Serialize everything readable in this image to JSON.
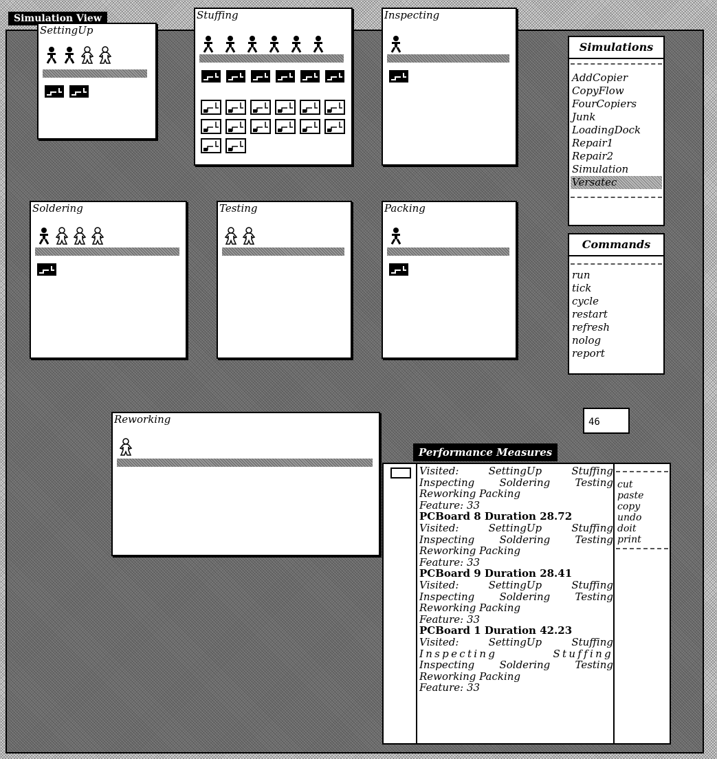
{
  "window": {
    "title": "Simulation View"
  },
  "stages": [
    {
      "title": "SettingUp",
      "workers": [
        "busy",
        "busy",
        "idle",
        "idle"
      ],
      "boards_done": 2,
      "boards_queued": 0
    },
    {
      "title": "Stuffing",
      "workers": [
        "busy",
        "busy",
        "busy",
        "busy",
        "busy",
        "busy"
      ],
      "boards_done": 6,
      "boards_queued": 14
    },
    {
      "title": "Inspecting",
      "workers": [
        "busy"
      ],
      "boards_done": 1,
      "boards_queued": 0
    },
    {
      "title": "Soldering",
      "workers": [
        "busy",
        "idle",
        "idle",
        "idle"
      ],
      "boards_done": 1,
      "boards_queued": 0
    },
    {
      "title": "Testing",
      "workers": [
        "idle",
        "idle"
      ],
      "boards_done": 0,
      "boards_queued": 0
    },
    {
      "title": "Packing",
      "workers": [
        "busy"
      ],
      "boards_done": 1,
      "boards_queued": 0
    },
    {
      "title": "Reworking",
      "workers": [
        "idle"
      ],
      "boards_done": 0,
      "boards_queued": 0
    }
  ],
  "simulations": {
    "title": "Simulations",
    "items": [
      "AddCopier",
      "CopyFlow",
      "FourCopiers",
      "Junk",
      "LoadingDock",
      "Repair1",
      "Repair2",
      "Simulation",
      "Versatec"
    ],
    "selected": "Versatec"
  },
  "commands": {
    "title": "Commands",
    "items": [
      "run",
      "tick",
      "cycle",
      "restart",
      "refresh",
      "nolog",
      "report"
    ]
  },
  "counter": {
    "value": "46"
  },
  "performance": {
    "title": "Performance Measures",
    "lines": [
      {
        "text": "Visited:  SettingUp  Stuffing",
        "style": "just"
      },
      {
        "text": "Inspecting  Soldering  Testing",
        "style": "just"
      },
      {
        "text": "Reworking Packing",
        "style": ""
      },
      {
        "text": "Feature: 33",
        "style": ""
      },
      {
        "text": "PCBoard 8 Duration 28.72",
        "style": "heading"
      },
      {
        "text": "Visited:  SettingUp  Stuffing",
        "style": "just"
      },
      {
        "text": "Inspecting  Soldering  Testing",
        "style": "just"
      },
      {
        "text": "Reworking Packing",
        "style": ""
      },
      {
        "text": "Feature: 33",
        "style": ""
      },
      {
        "text": "PCBoard 9 Duration 28.41",
        "style": "heading"
      },
      {
        "text": "Visited:  SettingUp  Stuffing",
        "style": "just"
      },
      {
        "text": "Inspecting  Soldering  Testing",
        "style": "just"
      },
      {
        "text": "Reworking Packing",
        "style": ""
      },
      {
        "text": "Feature: 33",
        "style": ""
      },
      {
        "text": "PCBoard 1 Duration 42.23",
        "style": "heading"
      },
      {
        "text": "Visited:  SettingUp  Stuffing",
        "style": "just"
      },
      {
        "text": "Inspecting   Stuffing",
        "style": "wide just"
      },
      {
        "text": "Inspecting  Soldering  Testing",
        "style": "just"
      },
      {
        "text": "Reworking Packing",
        "style": ""
      },
      {
        "text": "Feature: 33",
        "style": ""
      }
    ],
    "edit_menu": [
      "cut",
      "paste",
      "copy",
      "undo",
      "doit",
      "print"
    ]
  }
}
